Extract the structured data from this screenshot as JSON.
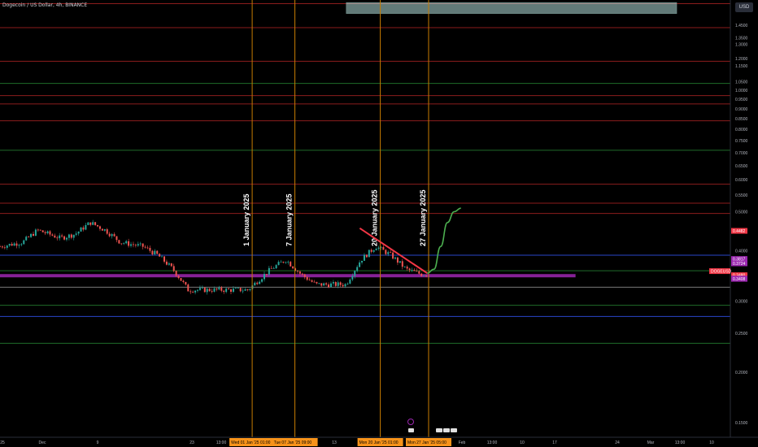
{
  "header": {
    "title": "Dogecoin / US Dollar, 4h, BINANCE",
    "currency_button": "USD"
  },
  "colors": {
    "background": "#000000",
    "candle_up": "#26a69a",
    "candle_down": "#ef5350",
    "red_level": "#b22222",
    "green_level": "#2e7d32",
    "blue_level": "#2962ff",
    "magenta_level": "#9c27b0",
    "event_line": "#c77c02",
    "trendline": "#f23645",
    "projection": "#4caf50",
    "supply_zone": "#b2dfdb"
  },
  "chart_data": {
    "type": "candlestick",
    "symbol": "DOGEUSD",
    "price_axis": {
      "min": 0.13,
      "max": 1.65,
      "scale": "log",
      "ticks": [
        "1.4500",
        "1.3500",
        "1.3000",
        "1.2000",
        "1.1500",
        "1.0500",
        "1.0000",
        "0.9500",
        "0.9000",
        "0.8500",
        "0.8000",
        "0.7500",
        "0.7000",
        "0.6500",
        "0.6000",
        "0.5500",
        "0.5000",
        "0.4500",
        "0.4000",
        "0.3500",
        "0.3000",
        "0.2500",
        "0.2000",
        "0.1500"
      ]
    },
    "time_axis": {
      "ticks": [
        "25",
        "Dec",
        "9",
        "23",
        "13:00",
        "13",
        "Feb",
        "13:00",
        "10",
        "17",
        "24",
        "Mar",
        "13:00",
        "10"
      ],
      "highlight_labels": [
        "Wed 01 Jan '25",
        "01:00",
        "Tue 07 Jan '25",
        "09:00",
        "Mon 20 Jan '25",
        "01:00",
        "Mon 27 Jan '25",
        "05:00"
      ]
    },
    "price_labels": [
      {
        "text": "0.4482",
        "value": 0.4482,
        "color": "#f23645"
      },
      {
        "text": "0.3817",
        "value": 0.3817,
        "color": "#9c27b0"
      },
      {
        "text": "0.3724",
        "value": 0.3724,
        "color": "#9c27b0"
      },
      {
        "text": "DOGEUSD",
        "value": 0.3562,
        "color": "#f23645"
      },
      {
        "text": "00:13",
        "value": 0.3562,
        "color": "#f23645"
      },
      {
        "text": "0.3480",
        "value": 0.348,
        "color": "#f23645"
      },
      {
        "text": "0.3413",
        "value": 0.3413,
        "color": "#9c27b0"
      },
      {
        "text": "0.3408",
        "value": 0.3408,
        "color": "#9c27b0"
      }
    ],
    "horizontal_levels": [
      {
        "value": 1.64,
        "color": "red"
      },
      {
        "value": 1.43,
        "color": "red"
      },
      {
        "value": 1.18,
        "color": "red"
      },
      {
        "value": 1.04,
        "color": "green"
      },
      {
        "value": 0.97,
        "color": "red"
      },
      {
        "value": 0.925,
        "color": "red"
      },
      {
        "value": 0.84,
        "color": "red"
      },
      {
        "value": 0.71,
        "color": "green"
      },
      {
        "value": 0.585,
        "color": "red"
      },
      {
        "value": 0.525,
        "color": "red"
      },
      {
        "value": 0.495,
        "color": "red"
      },
      {
        "value": 0.39,
        "color": "blue"
      },
      {
        "value": 0.357,
        "color": "green"
      },
      {
        "value": 0.325,
        "color": "grey"
      },
      {
        "value": 0.293,
        "color": "green"
      },
      {
        "value": 0.275,
        "color": "blue"
      },
      {
        "value": 0.236,
        "color": "green"
      }
    ],
    "event_lines": [
      {
        "label": "1 January 2025",
        "date": "2025-01-01T01:00"
      },
      {
        "label": "7 January 2025",
        "date": "2025-01-07T09:00"
      },
      {
        "label": "20 January 2025",
        "date": "2025-01-20T01:00"
      },
      {
        "label": "27 January 2025",
        "date": "2025-01-27T05:00"
      }
    ],
    "supply_zone": {
      "from": "2025-01-15",
      "to": "2025-03-05",
      "price_low": 1.55,
      "price_high": 1.65
    },
    "magenta_band": {
      "from": "2024-11-20",
      "to": "2025-02-18",
      "price": 0.347
    },
    "trendline": {
      "from": {
        "date": "2025-01-17",
        "price": 0.455
      },
      "to": {
        "date": "2025-01-27",
        "price": 0.352
      }
    },
    "projection": [
      {
        "date": "2025-01-27",
        "price": 0.352
      },
      {
        "date": "2025-01-28",
        "price": 0.36
      },
      {
        "date": "2025-01-29",
        "price": 0.41
      },
      {
        "date": "2025-01-30",
        "price": 0.47
      },
      {
        "date": "2025-01-31",
        "price": 0.5
      },
      {
        "date": "2025-02-01",
        "price": 0.51
      }
    ],
    "price_path": [
      [
        0,
        0.41
      ],
      [
        0.03,
        0.42
      ],
      [
        0.05,
        0.45
      ],
      [
        0.08,
        0.43
      ],
      [
        0.1,
        0.44
      ],
      [
        0.12,
        0.47
      ],
      [
        0.14,
        0.45
      ],
      [
        0.16,
        0.42
      ],
      [
        0.19,
        0.41
      ],
      [
        0.21,
        0.39
      ],
      [
        0.23,
        0.36
      ],
      [
        0.25,
        0.32
      ],
      [
        0.27,
        0.32
      ],
      [
        0.3,
        0.32
      ],
      [
        0.33,
        0.32
      ],
      [
        0.36,
        0.36
      ],
      [
        0.38,
        0.38
      ],
      [
        0.4,
        0.35
      ],
      [
        0.42,
        0.33
      ],
      [
        0.44,
        0.33
      ],
      [
        0.46,
        0.33
      ],
      [
        0.48,
        0.38
      ],
      [
        0.5,
        0.41
      ],
      [
        0.52,
        0.39
      ],
      [
        0.54,
        0.36
      ],
      [
        0.56,
        0.35
      ],
      [
        0.57,
        0.35
      ]
    ]
  }
}
